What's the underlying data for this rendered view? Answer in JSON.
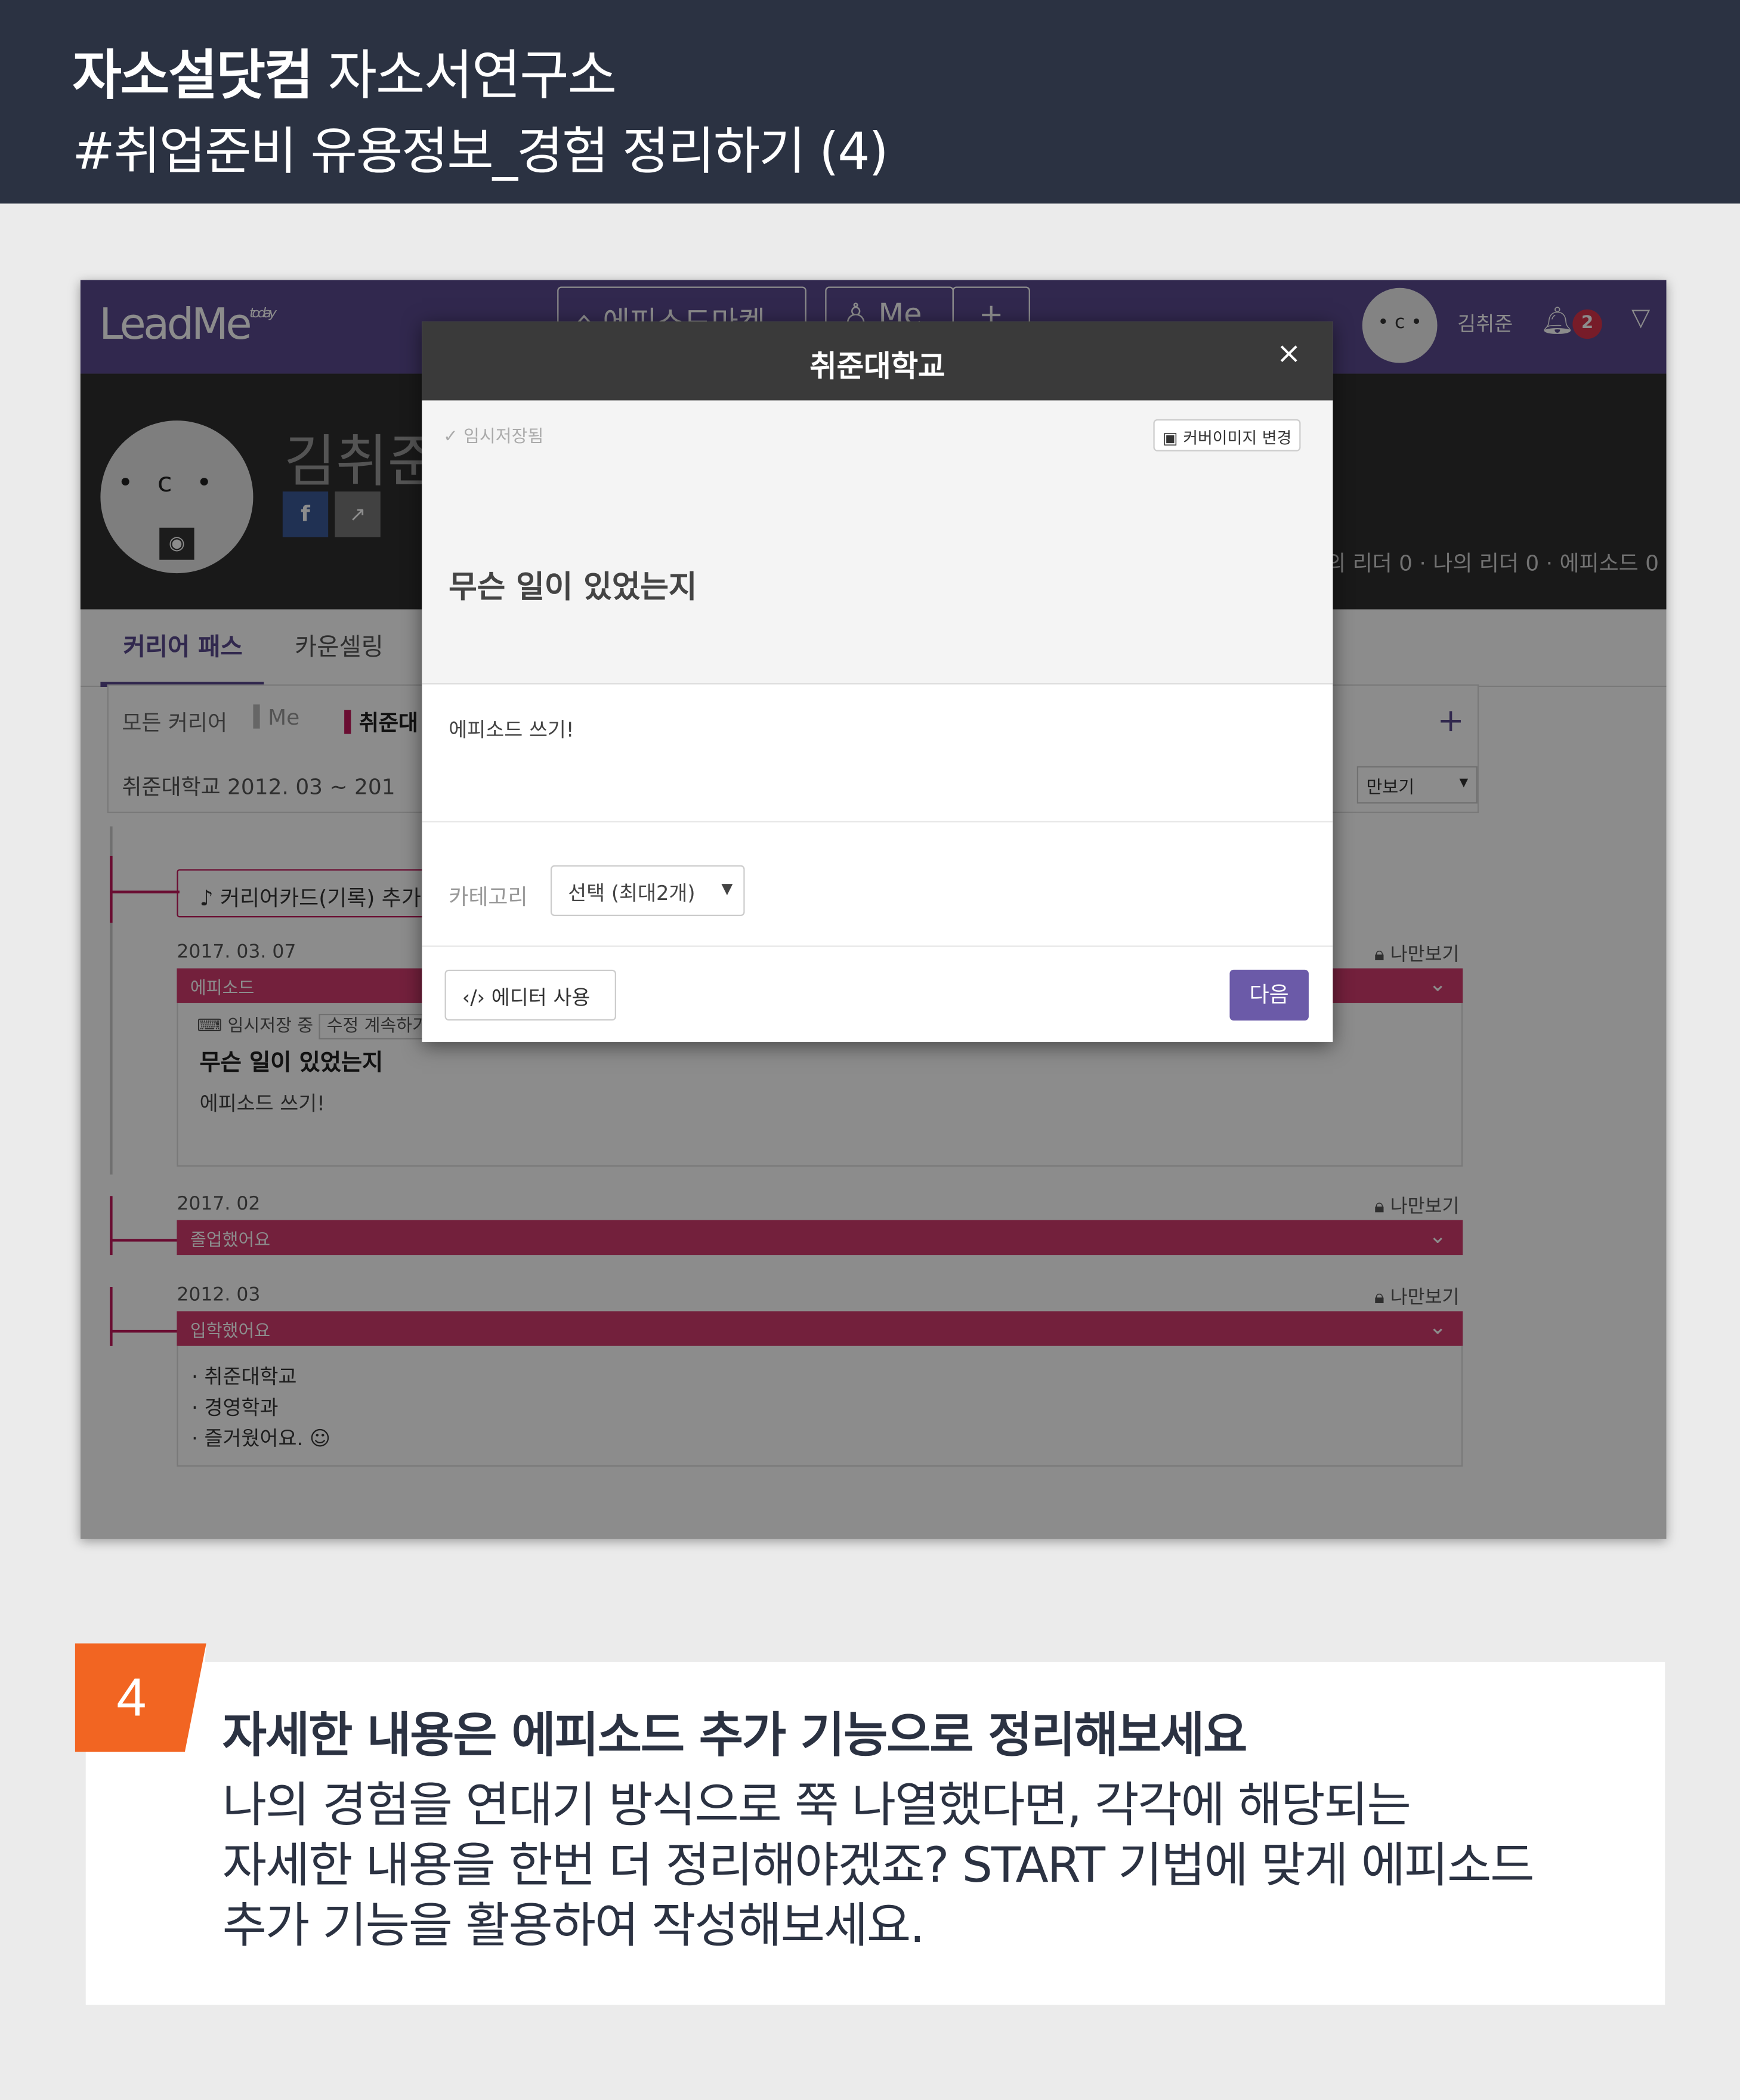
{
  "header": {
    "brand_bold": "자소설닷컴",
    "brand_rest": " 자소서연구소",
    "subtitle": "#취업준비 유용정보_경험 정리하기 (4)"
  },
  "app": {
    "logo": "LeadMe",
    "logo_tag": "today",
    "nav_buttons": [
      "에피소드마켓",
      "Me",
      "+"
    ],
    "user_name": "김취준",
    "notification_count": "2",
    "profile_name": "김취준",
    "stats": "의 리더 0 · 나의 리더 0 · 에피소드 0",
    "tabs": [
      "커리어 패스",
      "카운셀링"
    ],
    "filter_tabs": [
      "모든 커리어",
      "Me",
      "취준대"
    ],
    "filter_row": "취준대학교   2012. 03   ~   201",
    "filter_select": "만보기",
    "add_card_label": "커리어카드(기록) 추가",
    "entries": [
      {
        "date": "2017. 03. 07",
        "privacy": "나만보기",
        "bar_label": "에피소드",
        "temp_label": "임시저장 중",
        "continue_label": "수정 계속하기",
        "title": "무슨 일이 있었는지",
        "content": "에피소드 쓰기!"
      },
      {
        "date": "2017. 02",
        "privacy": "나만보기",
        "bar_label": "졸업했어요"
      },
      {
        "date": "2012. 03",
        "privacy": "나만보기",
        "bar_label": "입학했어요",
        "items": [
          "· 취준대학교",
          "· 경영학과",
          "· 즐거웠어요. ☺"
        ]
      }
    ]
  },
  "modal": {
    "title": "취준대학교",
    "close": "×",
    "saved_label": "임시저장됨",
    "cover_button": "커버이미지 변경",
    "headline": "무슨 일이 있었는지",
    "content": "에피소드 쓰기!",
    "category_label": "카테고리",
    "category_value": "선택 (최대2개)",
    "editor_button": "에디터 사용",
    "next_button": "다음"
  },
  "step": {
    "number": "4",
    "title": "자세한 내용은 에피소드 추가 기능으로 정리해보세요",
    "body": [
      "나의 경험을 연대기 방식으로 쭉 나열했다면, 각각에 해당되는",
      "자세한 내용을 한번 더 정리해야겠죠? START 기법에 맞게 에피소드",
      "추가 기능을 활용하여 작성해보세요."
    ]
  },
  "colors": {
    "banner": "#2b3242",
    "accent_purple": "#5a4a8f",
    "bar_pink": "#d23b6e",
    "step_orange": "#f26522"
  }
}
